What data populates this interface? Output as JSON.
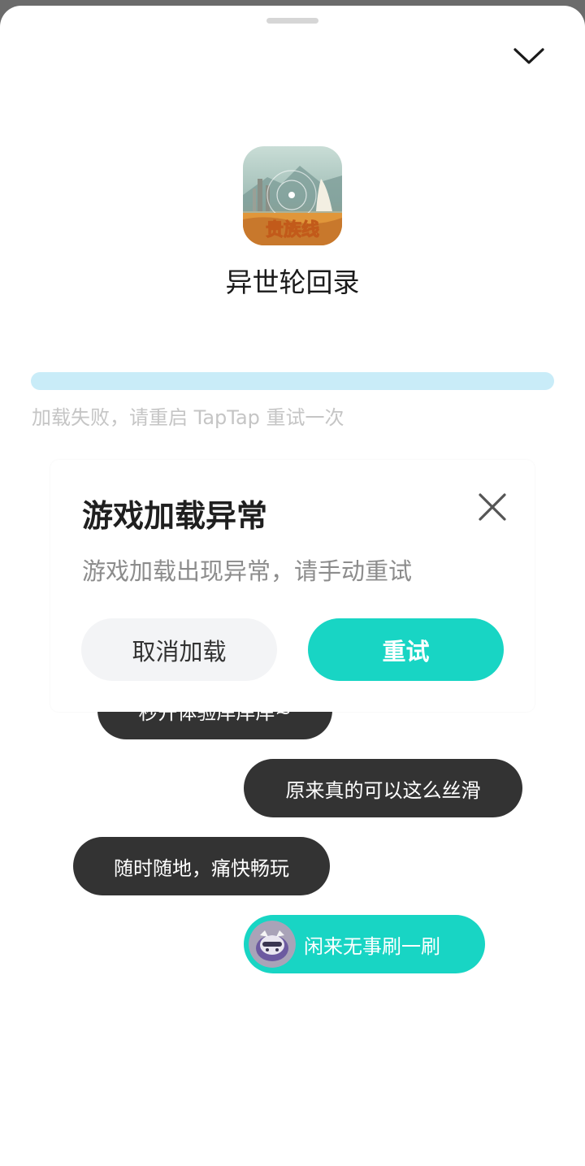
{
  "app": {
    "name": "异世轮回录",
    "icon_caption": "贵族线",
    "icon": "game-cover-icon"
  },
  "loading": {
    "progress": 1.0,
    "message": "加载失败，请重启 TapTap 重试一次"
  },
  "dialog": {
    "title": "游戏加载异常",
    "message": "游戏加载出现异常，请手动重试",
    "cancel_label": "取消加载",
    "retry_label": "重试"
  },
  "bubbles": [
    {
      "text": "秒开体验岸岸岸~"
    },
    {
      "text": "原来真的可以这么丝滑"
    },
    {
      "text": "随时随地，痛快畅玩"
    },
    {
      "text": "闲来无事刷一刷"
    }
  ],
  "colors": {
    "accent": "#18d5c4",
    "bubble_dark": "#333333",
    "progress_track": "#e6f4fc"
  }
}
